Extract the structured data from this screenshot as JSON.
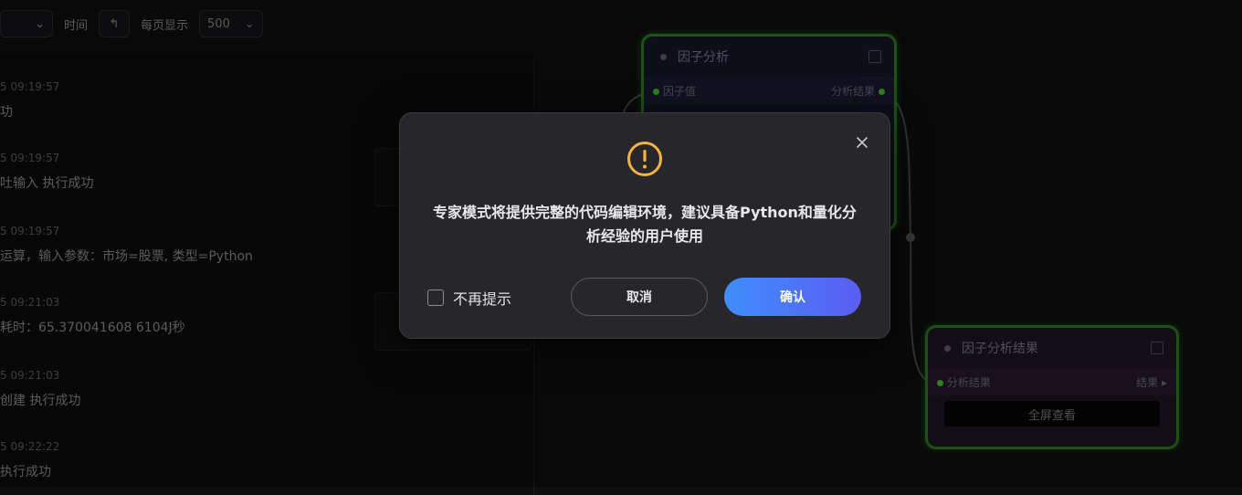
{
  "toolbar": {
    "select1_label": "",
    "time_label": "时间",
    "per_page_label": "每页显示",
    "per_page_value": "500"
  },
  "logs": [
    {
      "time": "5 09:19:57",
      "msg": "功"
    },
    {
      "time": "5 09:19:57",
      "msg": "吐输入 执行成功"
    },
    {
      "time": "5 09:19:57",
      "msg": "运算，输入参数：市场=股票, 类型=Python"
    },
    {
      "time": "5 09:21:03",
      "msg": "耗时：65.370041608 6104J秒"
    },
    {
      "time": "5 09:21:03",
      "msg": "创建 执行成功"
    },
    {
      "time": "5 09:22:22",
      "msg": "执行成功"
    }
  ],
  "nodes": {
    "factor_analysis": {
      "title": "因子分析",
      "in_port": "因子值",
      "out_port": "分析结果"
    },
    "factor_result": {
      "title": "因子分析结果",
      "in_port": "分析结果",
      "out_port": "结果",
      "button": "全屏查看"
    }
  },
  "modal": {
    "message": "专家模式将提供完整的代码编辑环境，建议具备Python和量化分析经验的用户使用",
    "checkbox_label": "不再提示",
    "cancel_label": "取消",
    "confirm_label": "确认",
    "icon": "warning-circle-icon",
    "accent_color": "#f5b342",
    "confirm_gradient": [
      "#3f8efc",
      "#5b5cf2"
    ]
  }
}
